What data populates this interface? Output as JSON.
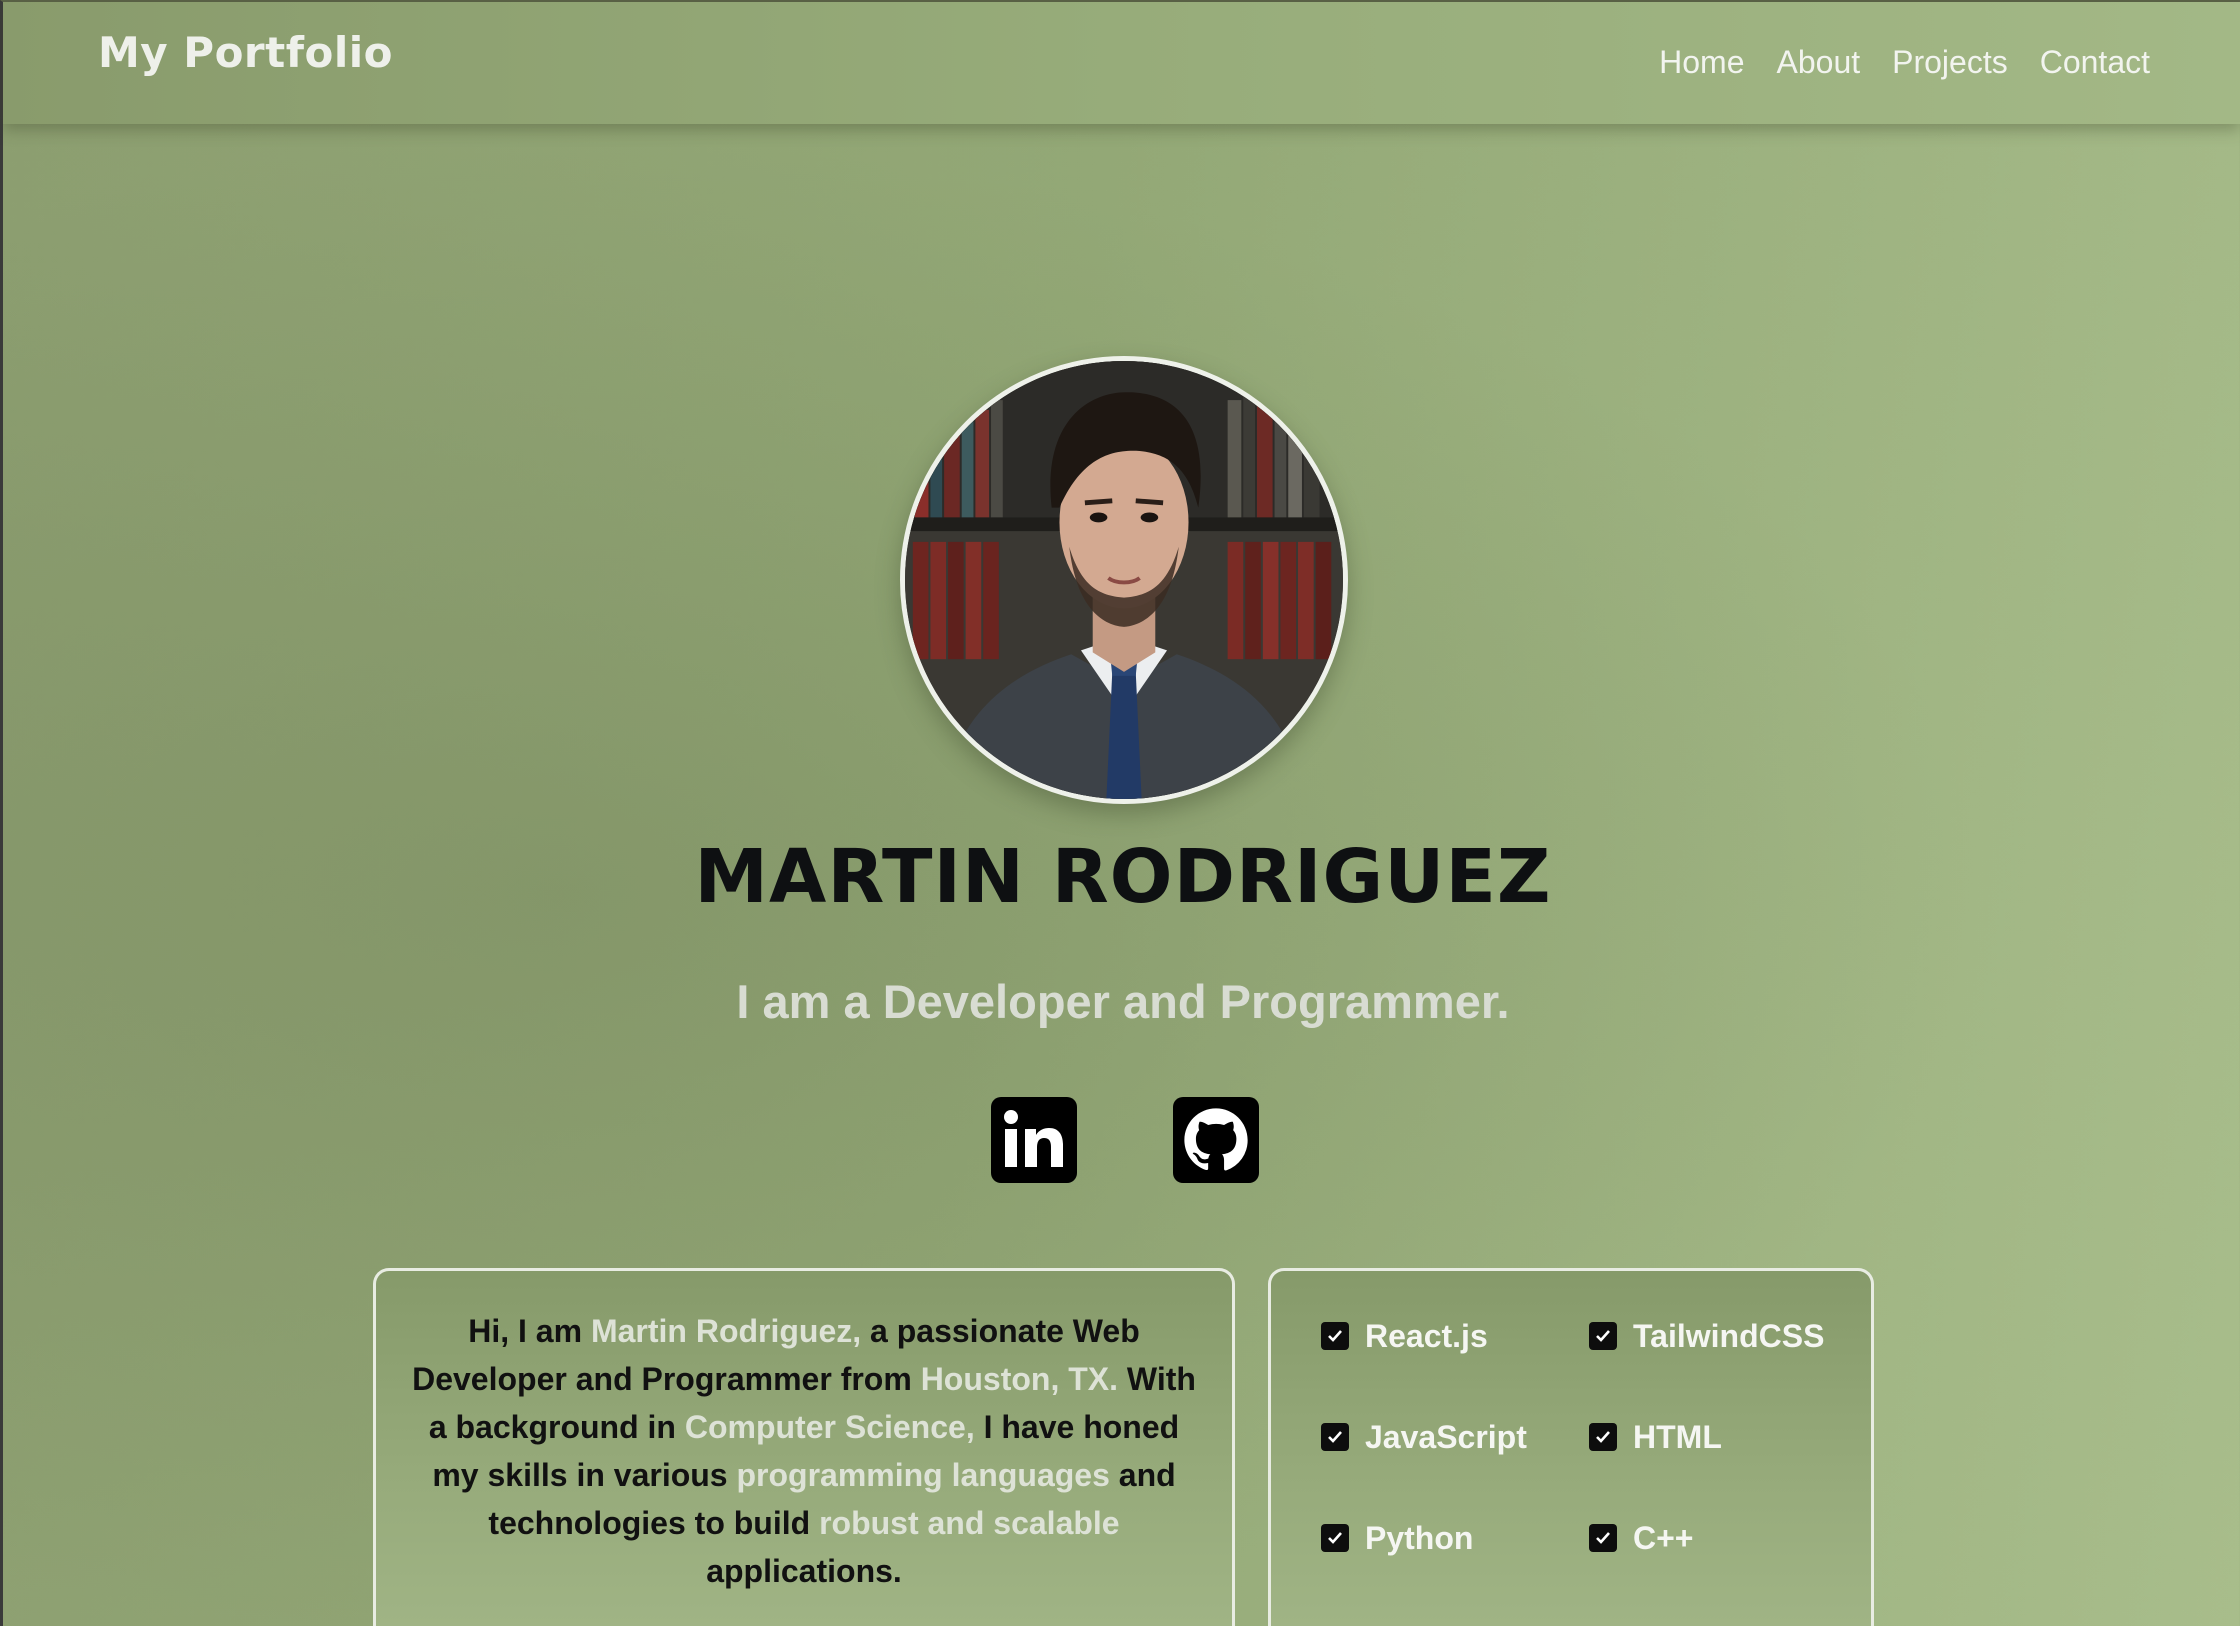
{
  "navbar": {
    "brand": "My Portfolio",
    "links": [
      "Home",
      "About",
      "Projects",
      "Contact"
    ]
  },
  "hero": {
    "name": "MARTIN RODRIGUEZ",
    "tagline": "I am a Developer and Programmer."
  },
  "socials": [
    {
      "icon": "linkedin-icon"
    },
    {
      "icon": "github-icon"
    }
  ],
  "about": {
    "p1": "Hi, I am ",
    "h1": "Martin Rodriguez,",
    "p2": " a passionate Web Developer and Programmer from ",
    "h2": "Houston, TX.",
    "p3": " With a background in ",
    "h3": "Computer Science,",
    "p4": " I have honed my skills in various ",
    "h4": "programming languages",
    "p5": " and technologies to build ",
    "h5": "robust and scalable",
    "p6": " applications."
  },
  "skills": [
    "React.js",
    "TailwindCSS",
    "JavaScript",
    "HTML",
    "Python",
    "C++"
  ],
  "colors": {
    "background": "#93a876",
    "highlight": "#dde2d6",
    "text_dark": "#111111",
    "border": "#e8ece2"
  }
}
